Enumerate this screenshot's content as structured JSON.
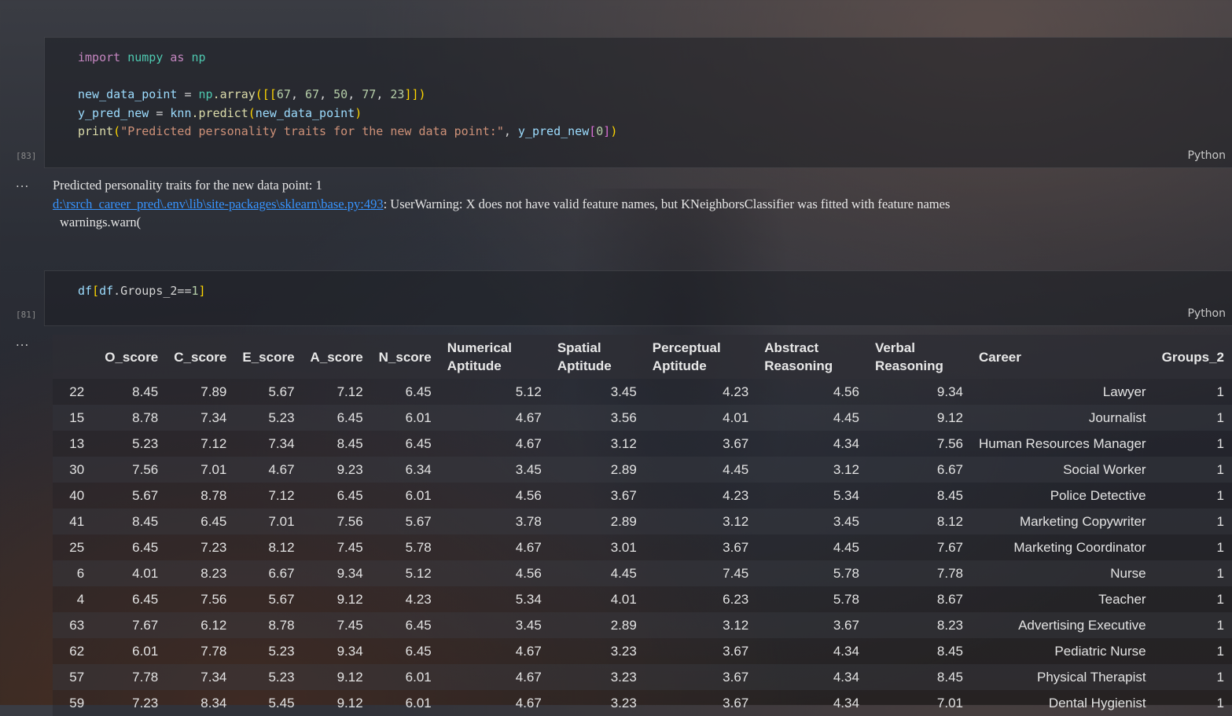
{
  "cell1": {
    "exec_count": "[83]",
    "lang": "Python",
    "code": {
      "l1_kw_import": "import",
      "l1_mod": "numpy",
      "l1_kw_as": "as",
      "l1_alias": "np",
      "l2_var": "new_data_point",
      "l2_eq": " = ",
      "l2_np": "np",
      "l2_fn": ".array",
      "l2_open": "([[",
      "l2_n1": "67",
      "l2_n2": "67",
      "l2_n3": "50",
      "l2_n4": "77",
      "l2_n5": "23",
      "l2_close": "]])",
      "l3_var": "y_pred_new",
      "l3_eq": " = ",
      "l3_obj": "knn",
      "l3_fn": ".predict",
      "l3_arg": "new_data_point",
      "l4_fn": "print",
      "l4_str": "\"Predicted personality traits for the new data point:\"",
      "l4_var": "y_pred_new",
      "l4_idx": "0"
    }
  },
  "output1": {
    "dots": "...",
    "line1": "Predicted personality traits for the new data point: 1",
    "link": "d:\\rsrch_career_pred\\.env\\lib\\site-packages\\sklearn\\base.py:493",
    "warning": ": UserWarning: X does not have valid feature names, but KNeighborsClassifier was fitted with feature names",
    "line3": "warnings.warn("
  },
  "cell2": {
    "exec_count": "[81]",
    "lang": "Python",
    "code_df": "df",
    "code_inner_df": "df",
    "code_rest": ".Groups_2==",
    "code_num": "1"
  },
  "output2": {
    "dots": "...",
    "columns": [
      "O_score",
      "C_score",
      "E_score",
      "A_score",
      "N_score",
      "Numerical Aptitude",
      "Spatial Aptitude",
      "Perceptual Aptitude",
      "Abstract Reasoning",
      "Verbal Reasoning",
      "Career",
      "Groups_2"
    ],
    "rows": [
      [
        "22",
        "8.45",
        "7.89",
        "5.67",
        "7.12",
        "6.45",
        "5.12",
        "3.45",
        "4.23",
        "4.56",
        "9.34",
        "Lawyer",
        "1"
      ],
      [
        "15",
        "8.78",
        "7.34",
        "5.23",
        "6.45",
        "6.01",
        "4.67",
        "3.56",
        "4.01",
        "4.45",
        "9.12",
        "Journalist",
        "1"
      ],
      [
        "13",
        "5.23",
        "7.12",
        "7.34",
        "8.45",
        "6.45",
        "4.67",
        "3.12",
        "3.67",
        "4.34",
        "7.56",
        "Human Resources Manager",
        "1"
      ],
      [
        "30",
        "7.56",
        "7.01",
        "4.67",
        "9.23",
        "6.34",
        "3.45",
        "2.89",
        "4.45",
        "3.12",
        "6.67",
        "Social Worker",
        "1"
      ],
      [
        "40",
        "5.67",
        "8.78",
        "7.12",
        "6.45",
        "6.01",
        "4.56",
        "3.67",
        "4.23",
        "5.34",
        "8.45",
        "Police Detective",
        "1"
      ],
      [
        "41",
        "8.45",
        "6.45",
        "7.01",
        "7.56",
        "5.67",
        "3.78",
        "2.89",
        "3.12",
        "3.45",
        "8.12",
        "Marketing Copywriter",
        "1"
      ],
      [
        "25",
        "6.45",
        "7.23",
        "8.12",
        "7.45",
        "5.78",
        "4.67",
        "3.01",
        "3.67",
        "4.45",
        "7.67",
        "Marketing Coordinator",
        "1"
      ],
      [
        "6",
        "4.01",
        "8.23",
        "6.67",
        "9.34",
        "5.12",
        "4.56",
        "4.45",
        "7.45",
        "5.78",
        "7.78",
        "Nurse",
        "1"
      ],
      [
        "4",
        "6.45",
        "7.56",
        "5.67",
        "9.12",
        "4.23",
        "5.34",
        "4.01",
        "6.23",
        "5.78",
        "8.67",
        "Teacher",
        "1"
      ],
      [
        "63",
        "7.67",
        "6.12",
        "8.78",
        "7.45",
        "6.45",
        "3.45",
        "2.89",
        "3.12",
        "3.67",
        "8.23",
        "Advertising Executive",
        "1"
      ],
      [
        "62",
        "6.01",
        "7.78",
        "5.23",
        "9.34",
        "6.45",
        "4.67",
        "3.23",
        "3.67",
        "4.34",
        "8.45",
        "Pediatric Nurse",
        "1"
      ],
      [
        "57",
        "7.78",
        "7.34",
        "5.23",
        "9.12",
        "6.01",
        "4.67",
        "3.23",
        "3.67",
        "4.34",
        "8.45",
        "Physical Therapist",
        "1"
      ],
      [
        "59",
        "7.23",
        "8.34",
        "5.45",
        "9.12",
        "6.01",
        "4.67",
        "3.23",
        "3.67",
        "4.34",
        "7.01",
        "Dental Hygienist",
        "1"
      ]
    ]
  }
}
